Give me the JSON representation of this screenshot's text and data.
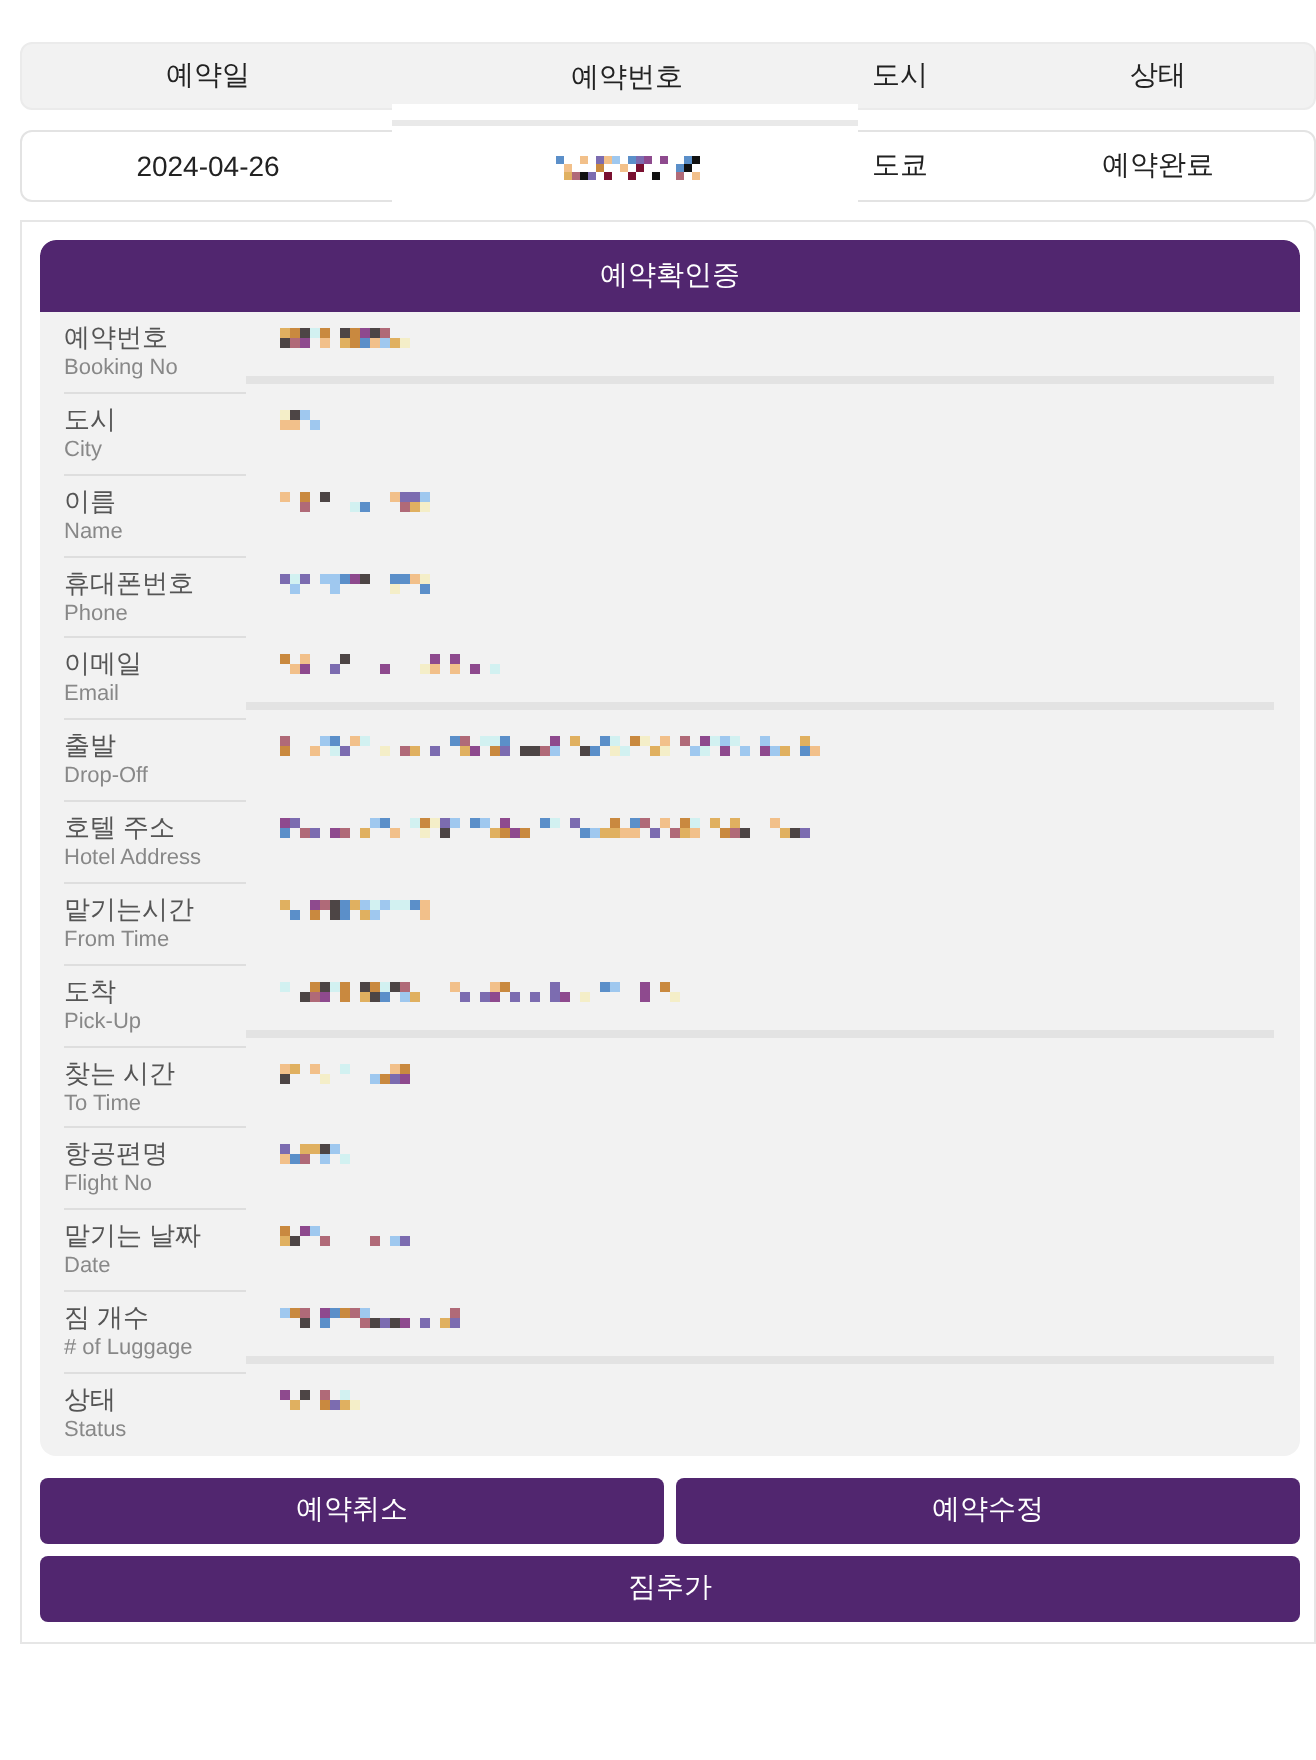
{
  "table": {
    "columns": [
      "예약일",
      "예약번호",
      "도시",
      "상태"
    ],
    "rows": [
      {
        "cells": [
          {
            "text": "2024-04-26"
          },
          {
            "pixelated": true
          },
          {
            "text": "도쿄"
          },
          {
            "text": "예약완료"
          }
        ]
      }
    ]
  },
  "certificate": {
    "title": "예약확인증",
    "sections": [
      {
        "fields": [
          {
            "label": "예약번호",
            "sublabel": "Booking No",
            "pixelated": true
          }
        ]
      },
      {
        "fields": [
          {
            "label": "도시",
            "sublabel": "City",
            "pixelated": true
          },
          {
            "label": "이름",
            "sublabel": "Name",
            "pixelated": true
          },
          {
            "label": "휴대폰번호",
            "sublabel": "Phone",
            "pixelated": true
          },
          {
            "label": "이메일",
            "sublabel": "Email",
            "pixelated": true
          }
        ]
      },
      {
        "fields": [
          {
            "label": "출발",
            "sublabel": "Drop-Off",
            "pixelated": true
          },
          {
            "label": "호텔 주소",
            "sublabel": "Hotel Address",
            "pixelated": true
          },
          {
            "label": "맡기는시간",
            "sublabel": "From Time",
            "pixelated": true
          },
          {
            "label": "도착",
            "sublabel": "Pick-Up",
            "pixelated": true
          }
        ]
      },
      {
        "fields": [
          {
            "label": "찾는 시간",
            "sublabel": "To Time",
            "pixelated": true
          },
          {
            "label": "항공편명",
            "sublabel": "Flight No",
            "pixelated": true
          },
          {
            "label": "맡기는 날짜",
            "sublabel": "Date",
            "pixelated": true
          },
          {
            "label": "짐 개수",
            "sublabel": "# of Luggage",
            "pixelated": true
          }
        ]
      },
      {
        "fields": [
          {
            "label": "상태",
            "sublabel": "Status",
            "pixelated": true
          }
        ]
      }
    ]
  },
  "buttons": [
    {
      "label": "예약취소"
    },
    {
      "label": "예약수정"
    },
    {
      "label": "짐추가"
    }
  ]
}
